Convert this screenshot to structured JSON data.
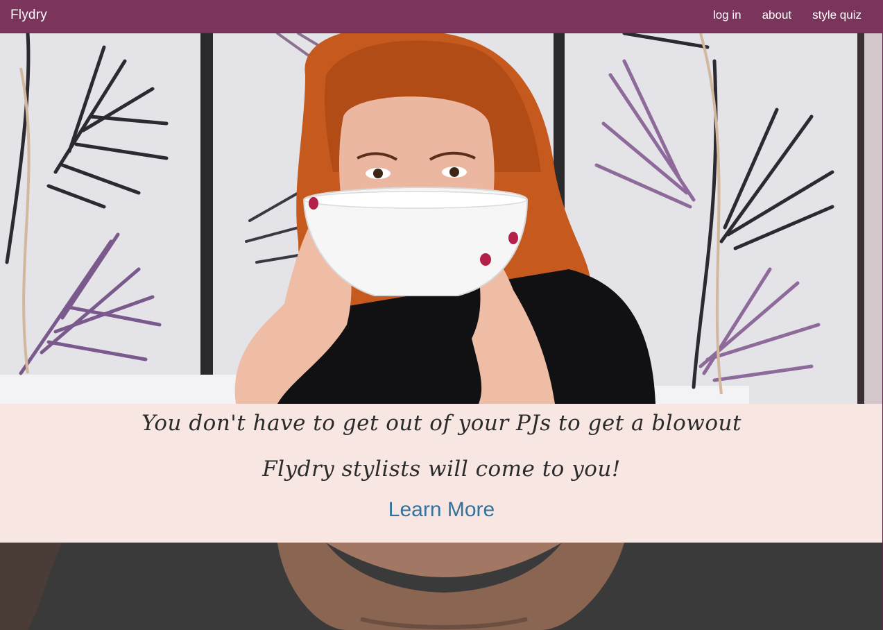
{
  "navbar": {
    "brand": "Flydry",
    "links": [
      {
        "label": "log in"
      },
      {
        "label": "about"
      },
      {
        "label": "style quiz"
      }
    ],
    "background_color": "#7b345c"
  },
  "hero": {
    "image": "woman-with-bowl-photo"
  },
  "banner": {
    "tagline_line1": "You don't have to get out of your PJs to get a blowout",
    "tagline_line2": "Flydry stylists will come to you!",
    "cta_label": "Learn More",
    "background_color": "#f7e6e2",
    "cta_color": "#33729e"
  },
  "lower_section": {
    "image": "close-up-photo"
  }
}
